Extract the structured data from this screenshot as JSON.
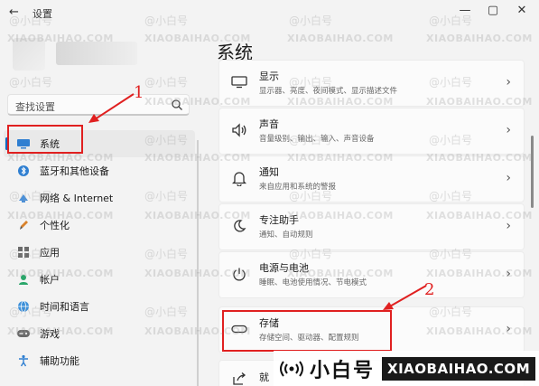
{
  "window": {
    "back_glyph": "←",
    "title": "设置",
    "minimize_glyph": "—",
    "maximize_glyph": "▢",
    "close_glyph": "✕"
  },
  "search": {
    "placeholder": "查找设置",
    "icon": "search-icon"
  },
  "sidebar": {
    "items": [
      {
        "label": "系统",
        "icon": "monitor-icon",
        "selected": true
      },
      {
        "label": "蓝牙和其他设备",
        "icon": "bluetooth-icon"
      },
      {
        "label": "网络 & Internet",
        "icon": "network-icon"
      },
      {
        "label": "个性化",
        "icon": "brush-icon"
      },
      {
        "label": "应用",
        "icon": "apps-icon"
      },
      {
        "label": "帐户",
        "icon": "account-icon"
      },
      {
        "label": "时间和语言",
        "icon": "globe-icon"
      },
      {
        "label": "游戏",
        "icon": "game-icon"
      },
      {
        "label": "辅助功能",
        "icon": "accessibility-icon"
      }
    ]
  },
  "main": {
    "title": "系统",
    "cards": [
      {
        "title": "显示",
        "subtitle": "显示器、亮度、夜间模式、显示描述文件",
        "icon": "display-icon"
      },
      {
        "title": "声音",
        "subtitle": "音量级别、输出、输入、声音设备",
        "icon": "sound-icon"
      },
      {
        "title": "通知",
        "subtitle": "来自应用和系统的警报",
        "icon": "bell-icon"
      },
      {
        "title": "专注助手",
        "subtitle": "通知、自动规则",
        "icon": "moon-icon"
      },
      {
        "title": "电源与电池",
        "subtitle": "睡眠、电池使用情况、节电模式",
        "icon": "power-icon"
      },
      {
        "title": "存储",
        "subtitle": "存储空间、驱动器、配置规则",
        "icon": "storage-icon"
      },
      {
        "title": "就",
        "subtitle": "",
        "icon": "share-icon"
      }
    ],
    "chevron": "›"
  },
  "annotations": {
    "one": "1",
    "two": "2",
    "color": "#e02020"
  },
  "watermark": {
    "handle": "@小白号",
    "site": "XIAOBAIHAO.COM",
    "brand_cn": "小白号",
    "brand_en": "XIAOBAIHAO.COM"
  },
  "colors": {
    "accent": "#0067c0",
    "background": "#f3f3f3",
    "card": "#fbfbfb"
  }
}
